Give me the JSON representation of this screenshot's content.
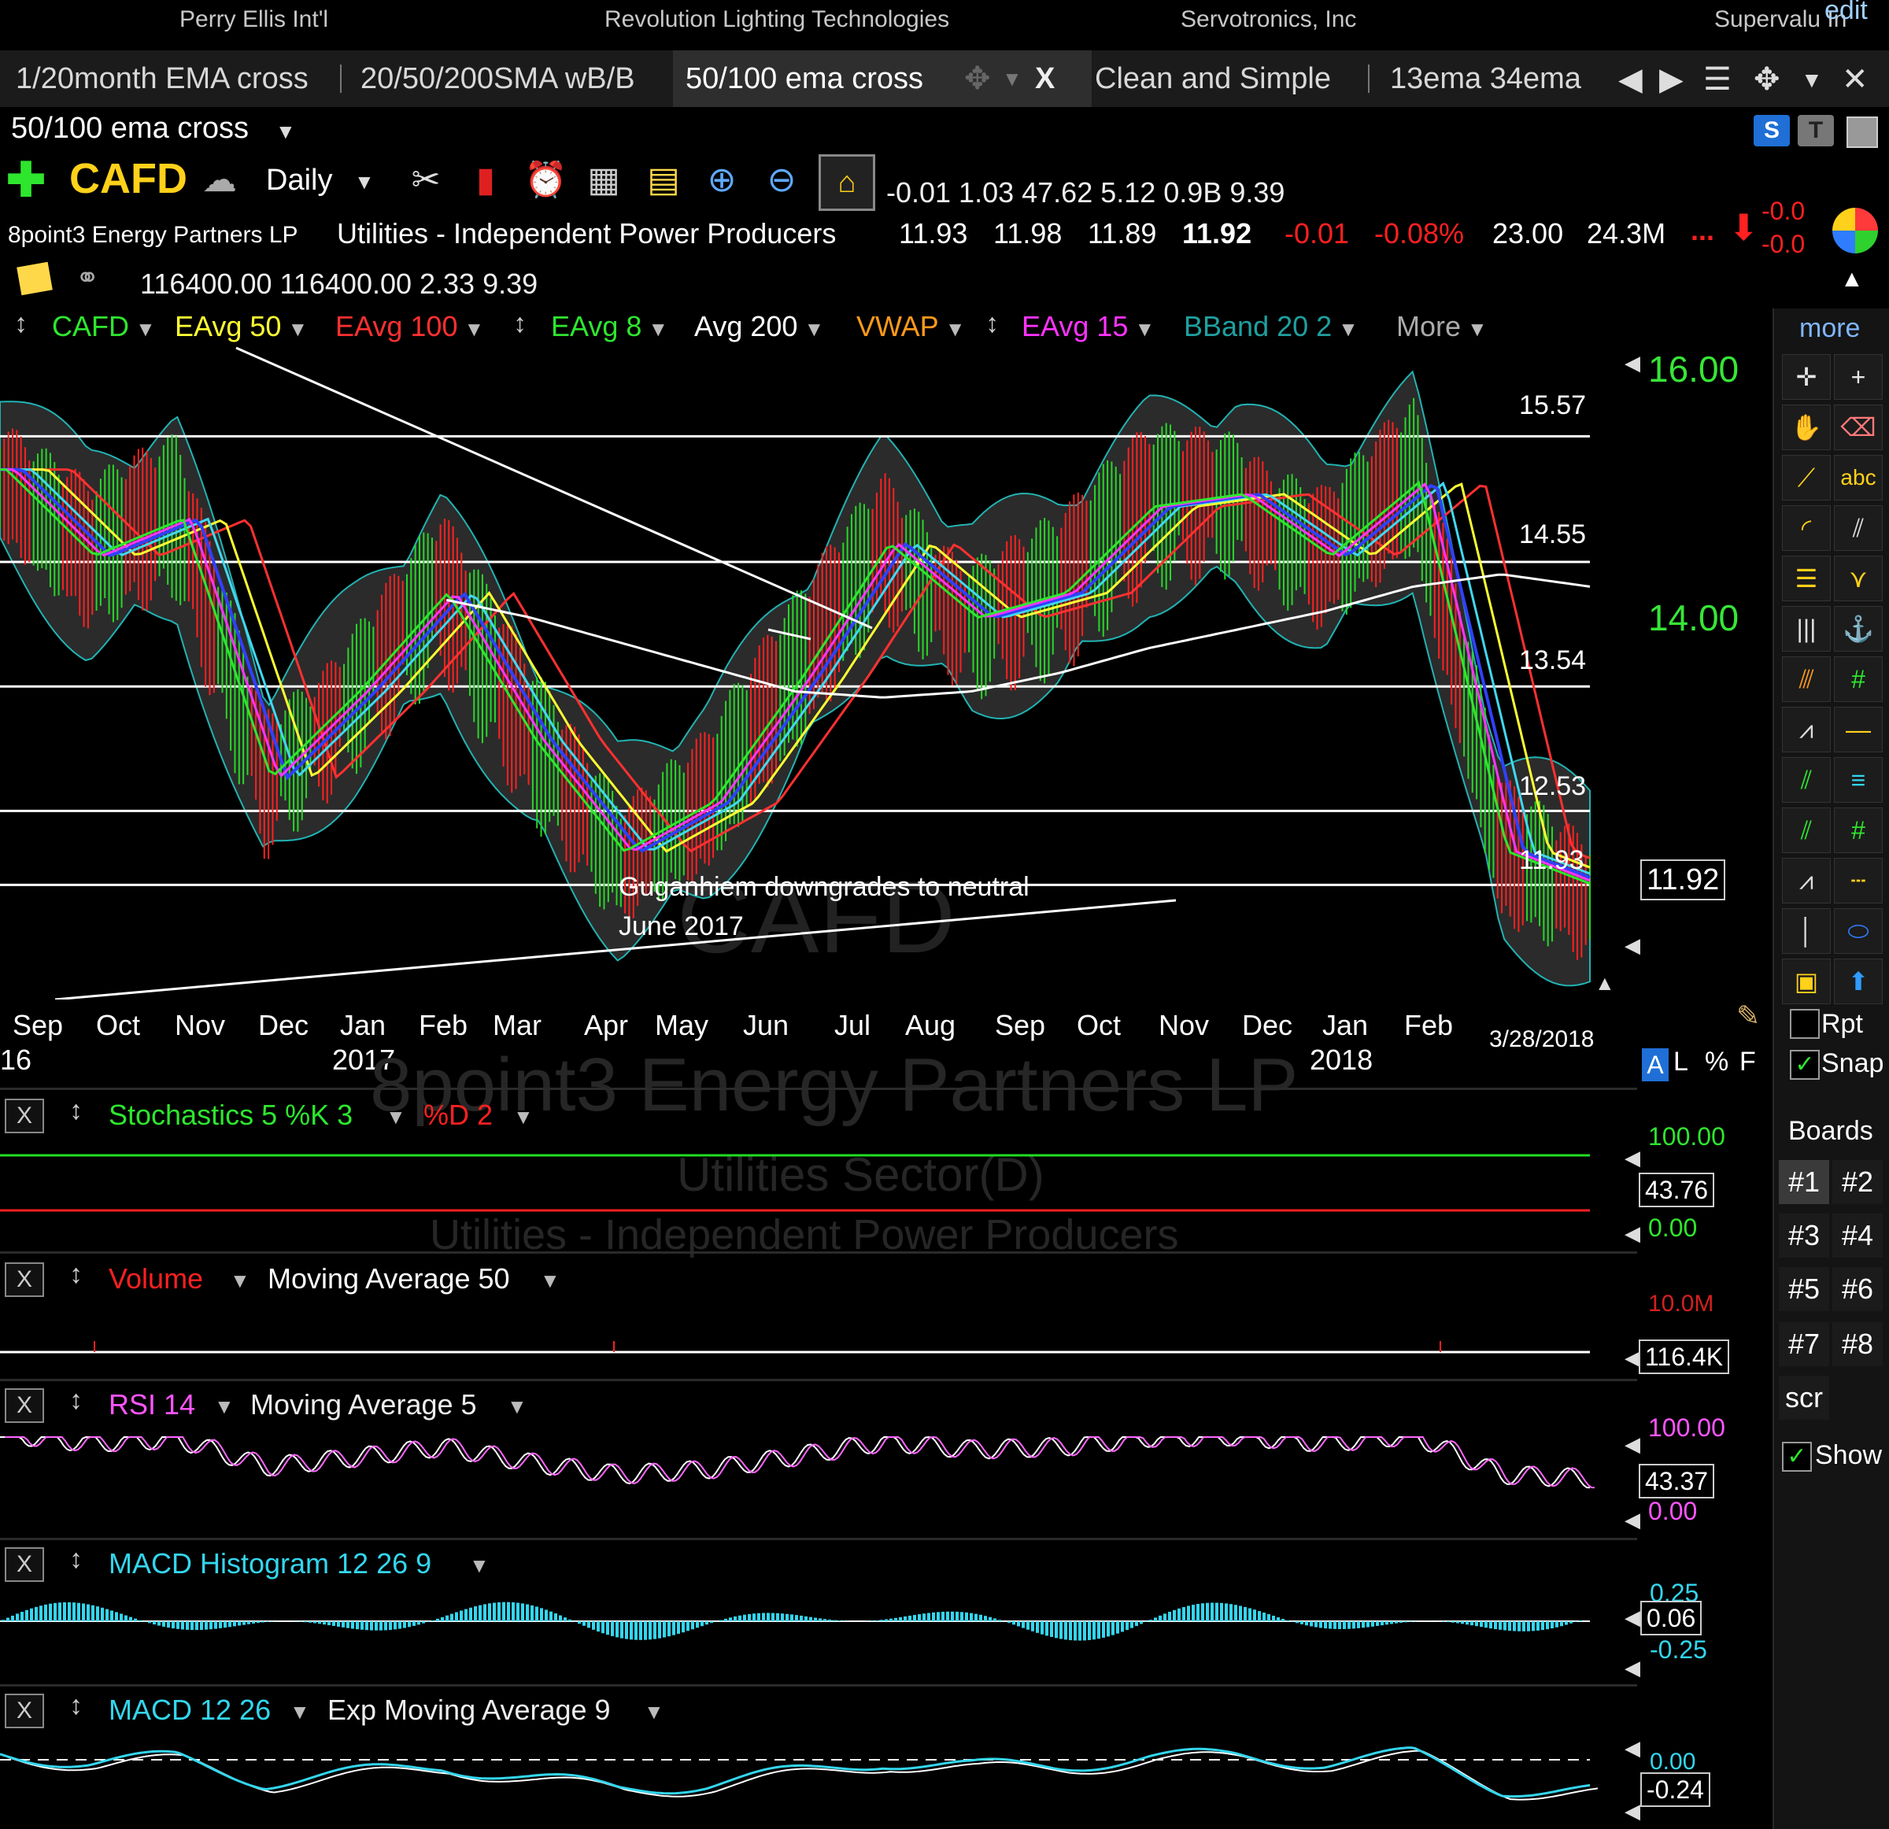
{
  "ticker": [
    {
      "name": "Perry Ellis Int'l"
    },
    {
      "name": "Revolution Lighting Technologies"
    },
    {
      "name": "Servotronics, Inc"
    },
    {
      "name": "Supervalu In"
    }
  ],
  "ticker_edit": "edit",
  "tabs": [
    "1/20month EMA cross",
    "20/50/200SMA wB/B",
    "50/100 ema cross",
    "Clean and Simple",
    "13ema 34ema"
  ],
  "active_tab_close": "X",
  "chart_title": "50/100 ema cross",
  "symbol": "CAFD",
  "period": "Daily",
  "quote_stats": "-0.01  1.03  47.62  5.12  0.9B  9.39",
  "company": "8point3 Energy Partners LP",
  "industry": "Utilities - Independent Power Producers",
  "ohlc": {
    "open": "11.93",
    "high": "11.98",
    "low": "11.89",
    "last": "11.92",
    "change": "-0.01",
    "pct": "-0.08%",
    "v1": "23.00",
    "vol": "24.3M",
    "dots": "...",
    "r1": "-0.0",
    "r2": "-0.0"
  },
  "row3": "116400.00  116400.00  2.33  9.39",
  "indicators": [
    {
      "label": "CAFD",
      "color": "#2ee62e"
    },
    {
      "label": "EAvg 50",
      "color": "#ffff33"
    },
    {
      "label": "EAvg 100",
      "color": "#ff3030"
    },
    {
      "label": "EAvg 8",
      "color": "#2ee62e"
    },
    {
      "label": "Avg 200",
      "color": "#ffffff"
    },
    {
      "label": "VWAP",
      "color": "#ff9a1a"
    },
    {
      "label": "EAvg 15",
      "color": "#ff33ff"
    },
    {
      "label": "BBand 20 2",
      "color": "#1fa0a0"
    },
    {
      "label": "More",
      "color": "#aaaaaa"
    }
  ],
  "price_scale": [
    "16.00",
    "14.00"
  ],
  "price_levels": [
    "15.57",
    "14.55",
    "13.54",
    "12.53",
    "11.93"
  ],
  "last_price_box": "11.92",
  "annotation": {
    "line1": "Guganhiem downgrades to neutral",
    "line2": "June 2017"
  },
  "watermark": {
    "symbol": "CAFD",
    "company": "8point3 Energy Partners LP",
    "sector": "Utilities Sector(D)",
    "industry": "Utilities - Independent Power Producers"
  },
  "x_months": [
    "Sep",
    "Oct",
    "Nov",
    "Dec",
    "Jan",
    "Feb",
    "Mar",
    "Apr",
    "May",
    "Jun",
    "Jul",
    "Aug",
    "Sep",
    "Oct",
    "Nov",
    "Dec",
    "Jan",
    "Feb"
  ],
  "x_years": [
    "16",
    "2017",
    "2018"
  ],
  "chart_date": "3/28/2018",
  "scale_opts": {
    "a": "A",
    "l": "L",
    "pct": "%",
    "f": "F"
  },
  "right_panel": {
    "more": "more",
    "rpt": "Rpt",
    "snap": "Snap",
    "boards_title": "Boards",
    "boards": [
      "#1",
      "#2",
      "#3",
      "#4",
      "#5",
      "#6",
      "#7",
      "#8"
    ],
    "scr": "scr",
    "show": "Show"
  },
  "panels": {
    "stoch": {
      "label": "Stochastics 5 %K 3",
      "d_label": "%D 2",
      "top": "100.00",
      "value": "43.76",
      "bottom": "0.00"
    },
    "volume": {
      "label": "Volume",
      "ma_label": "Moving Average 50",
      "top": "10.0M",
      "value": "116.4K"
    },
    "rsi": {
      "label": "RSI 14",
      "ma_label": "Moving Average 5",
      "top": "100.00",
      "value": "43.37",
      "bottom": "0.00"
    },
    "macdh": {
      "label": "MACD Histogram 12 26 9",
      "top": "0.25",
      "value": "0.06",
      "bottom": "-0.25"
    },
    "macd": {
      "label": "MACD 12 26",
      "ma_label": "Exp Moving Average 9",
      "top": "0.00",
      "value": "-0.24"
    }
  },
  "x_close": "X",
  "colors": {
    "up": "#27d827",
    "down": "#ff2020",
    "bband": "#22b3b3",
    "ema8": "#2ee62e",
    "ema50": "#ffff33",
    "ema100": "#ff3030",
    "avg200": "#ffffff",
    "ema15": "#ff33ff",
    "ema_blue": "#3040ff",
    "cyan": "#40d8f0"
  },
  "chart_data": {
    "type": "line",
    "symbol": "CAFD",
    "period": "Daily",
    "x": [
      "Sep 2016",
      "Oct",
      "Nov",
      "Dec",
      "Jan 2017",
      "Feb",
      "Mar",
      "Apr",
      "May",
      "Jun",
      "Jul",
      "Aug",
      "Sep",
      "Oct",
      "Nov",
      "Dec",
      "Jan 2018",
      "Feb",
      "Mar 2018"
    ],
    "series": [
      {
        "name": "CAFD",
        "values": [
          15.3,
          14.6,
          14.9,
          12.8,
          13.5,
          14.3,
          13.1,
          12.2,
          12.6,
          13.6,
          14.7,
          14.1,
          14.3,
          15.0,
          15.1,
          14.6,
          15.2,
          12.2,
          11.92
        ]
      },
      {
        "name": "Avg 200",
        "values": [
          null,
          null,
          null,
          null,
          null,
          14.25,
          14.1,
          13.9,
          13.7,
          13.5,
          13.45,
          13.5,
          13.65,
          13.85,
          14.0,
          14.15,
          14.35,
          14.45,
          14.35
        ]
      }
    ],
    "ylim": [
      11.0,
      16.3
    ],
    "price_levels": [
      15.57,
      14.55,
      13.54,
      12.53,
      11.93
    ],
    "last": 11.92
  }
}
